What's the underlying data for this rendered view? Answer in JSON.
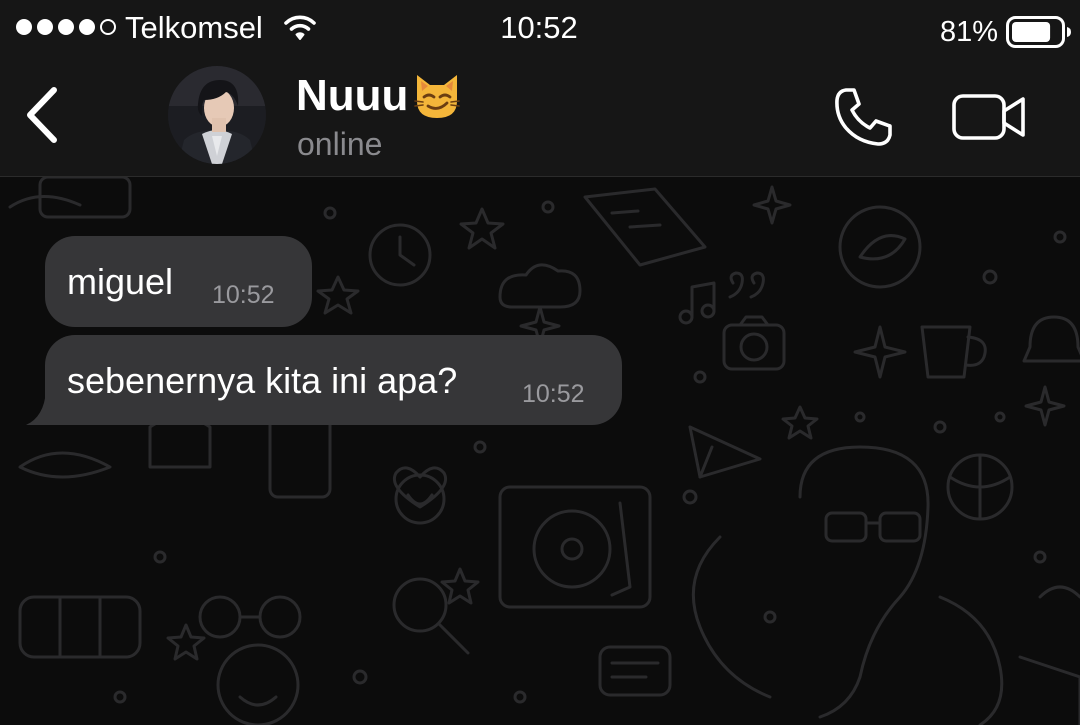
{
  "status_bar": {
    "signal_bars_filled": 4,
    "signal_bars_total": 5,
    "carrier": "Telkomsel",
    "wifi_icon": "wifi-icon",
    "time": "10:52",
    "battery_percent_label": "81%",
    "battery_level": 0.81
  },
  "header": {
    "back_icon": "chevron-left-icon",
    "avatar_icon": "profile-photo",
    "contact_name": "Nuuu",
    "name_emoji_icon": "smirking-cat-emoji",
    "status": "online",
    "call_icon": "phone-icon",
    "video_icon": "video-camera-icon"
  },
  "messages": [
    {
      "direction": "incoming",
      "text": "miguel",
      "time": "10:52"
    },
    {
      "direction": "incoming",
      "text": "sebenernya kita ini apa?",
      "time": "10:52"
    }
  ],
  "colors": {
    "bar_background": "#161616",
    "chat_background": "#0c0c0c",
    "bubble_incoming": "#363638",
    "status_text": "#8a8a8e",
    "timestamp": "#9a9a9e"
  }
}
